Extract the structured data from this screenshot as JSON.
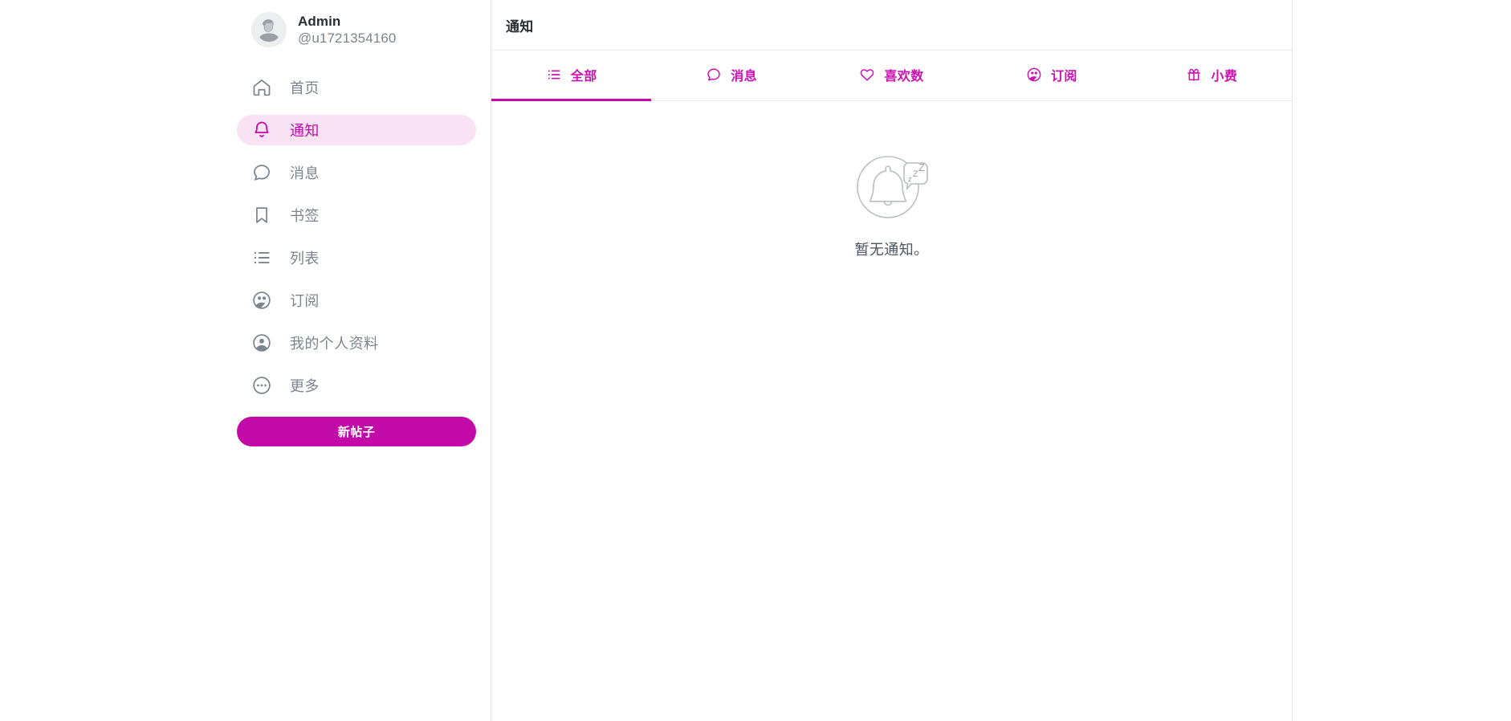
{
  "theme": {
    "accent": "#c20aa8",
    "accent_light": "#f9e2f4",
    "tab_accent": "#cc11b2",
    "muted_text": "#7c858f",
    "dark_text": "#2a2e35",
    "border": "#e3e5e8"
  },
  "sidebar": {
    "profile": {
      "avatar_icon": "default-user-avatar",
      "display_name": "Admin",
      "handle": "@u1721354160"
    },
    "nav_items": [
      {
        "label": "首页",
        "icon": "home-icon",
        "active": false
      },
      {
        "label": "通知",
        "icon": "bell-icon",
        "active": true
      },
      {
        "label": "消息",
        "icon": "chat-icon",
        "active": false
      },
      {
        "label": "书签",
        "icon": "bookmark-icon",
        "active": false
      },
      {
        "label": "列表",
        "icon": "list-icon",
        "active": false
      },
      {
        "label": "订阅",
        "icon": "people-icon",
        "active": false
      },
      {
        "label": "我的个人资料",
        "icon": "profile-icon",
        "active": false
      },
      {
        "label": "更多",
        "icon": "ellipsis-icon",
        "active": false
      }
    ],
    "new_post_button": "新帖子"
  },
  "main": {
    "header_title": "通知",
    "tabs": [
      {
        "label": "全部",
        "icon": "list-icon",
        "active": true
      },
      {
        "label": "消息",
        "icon": "chat-icon",
        "active": false
      },
      {
        "label": "喜欢数",
        "icon": "heart-icon",
        "active": false
      },
      {
        "label": "订阅",
        "icon": "people-icon",
        "active": false
      },
      {
        "label": "小费",
        "icon": "gift-icon",
        "active": false
      }
    ],
    "empty_state": {
      "icon": "sleeping-bell-icon",
      "message": "暂无通知。"
    }
  }
}
